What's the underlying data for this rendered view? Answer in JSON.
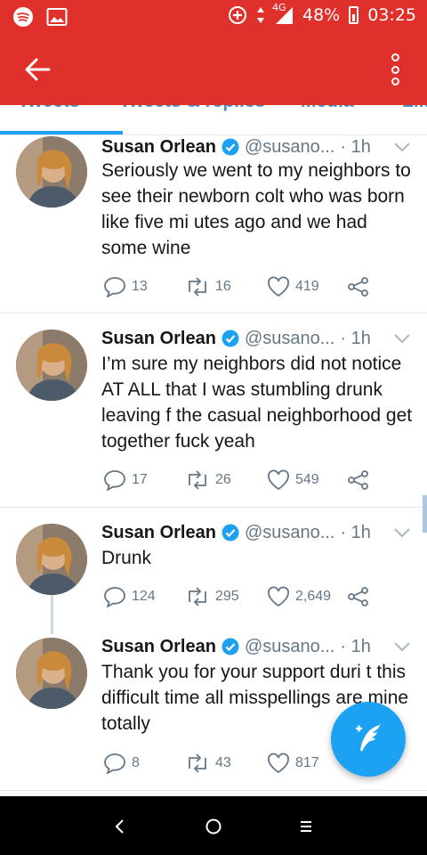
{
  "status_bar": {
    "network": "4G",
    "battery_percent": "48%",
    "time": "03:25",
    "icons": [
      "spotify-icon",
      "gallery-icon",
      "data-saver-icon",
      "data-arrows-icon",
      "signal-icon",
      "battery-icon"
    ]
  },
  "app_bar": {
    "back_icon": "arrow-left-icon",
    "menu_icon": "more-vertical-icon",
    "color": "#e0302c"
  },
  "tabs": [
    {
      "label": "Tweets",
      "active": true
    },
    {
      "label": "Tweets & replies",
      "active": false
    },
    {
      "label": "Media",
      "active": false
    },
    {
      "label": "Lik",
      "active": false
    }
  ],
  "tweets": [
    {
      "name": "Susan Orlean",
      "handle": "@susano...",
      "time": "· 1h",
      "text": "Seriously we went to my neighbors to see their newborn colt who was born like five mi utes ago and we had some wine",
      "replies": "13",
      "retweets": "16",
      "likes": "419"
    },
    {
      "name": "Susan Orlean",
      "handle": "@susano...",
      "time": "· 1h",
      "text": "I’m sure my neighbors did not notice AT ALL that I was stumbling drunk leaving f the casual neighborhood get together fuck yeah",
      "replies": "17",
      "retweets": "26",
      "likes": "549"
    },
    {
      "name": "Susan Orlean",
      "handle": "@susano...",
      "time": "· 1h",
      "text": "Drunk",
      "replies": "124",
      "retweets": "295",
      "likes": "2,649"
    },
    {
      "name": "Susan Orlean",
      "handle": "@susano...",
      "time": "· 1h",
      "text": "Thank you for your support duri t this difficult time all misspellings are mine totally",
      "replies": "8",
      "retweets": "43",
      "likes": "817"
    }
  ],
  "fab": {
    "icon": "compose-tweet-icon",
    "color": "#1da1f2"
  },
  "nav_bar": {
    "back": "‹",
    "home": "○",
    "recents": "☰"
  }
}
